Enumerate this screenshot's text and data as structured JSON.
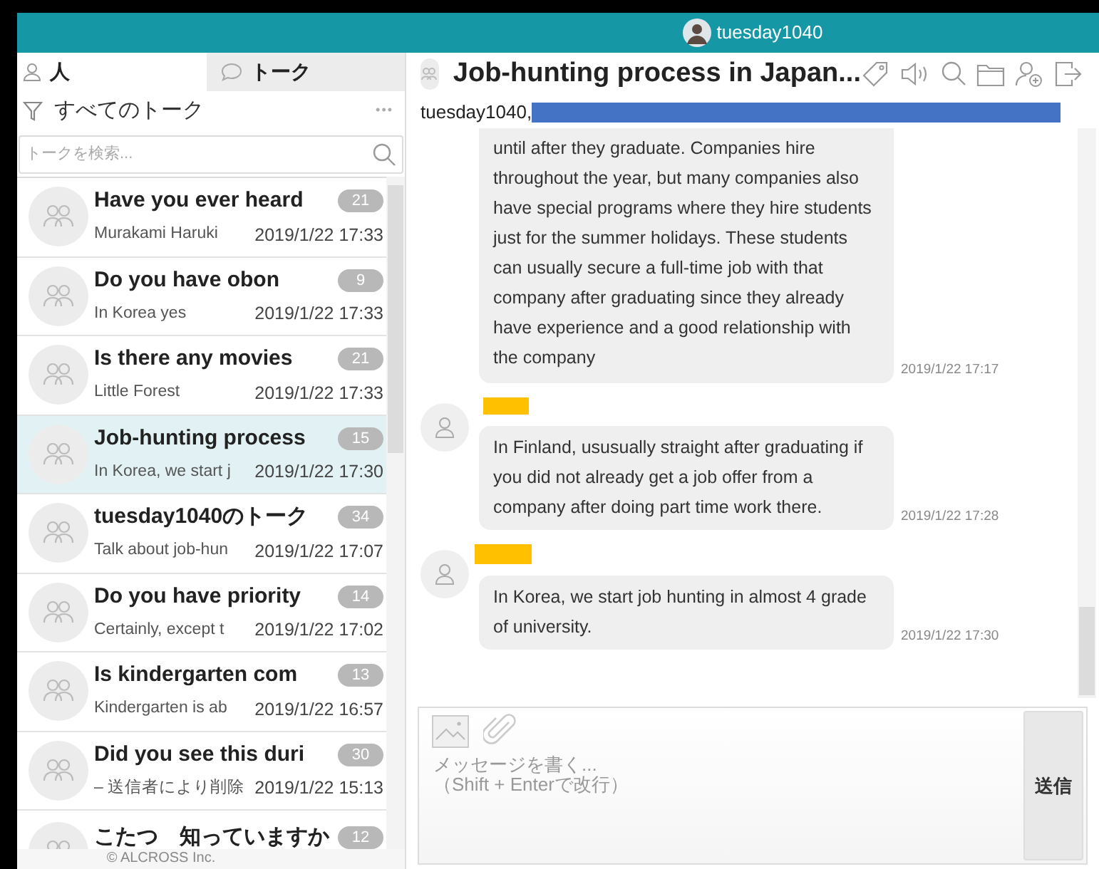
{
  "app_bar": {
    "user": "tuesday1040"
  },
  "tabs": [
    {
      "label": "人",
      "kind": "people",
      "selected": false
    },
    {
      "label": "トーク",
      "kind": "talk",
      "selected": true
    }
  ],
  "filter": {
    "label": "すべてのトーク",
    "more": "•••"
  },
  "search": {
    "placeholder": "トークを検索..."
  },
  "talks": [
    {
      "title": "Have you ever heard",
      "preview": "Murakami Haruki",
      "time": "2019/1/22 17:33",
      "count": "21",
      "selected": false
    },
    {
      "title": "Do you have obon",
      "preview": "In Korea yes",
      "time": "2019/1/22 17:33",
      "count": "9",
      "selected": false
    },
    {
      "title": "Is there any movies",
      "preview": "Little Forest",
      "time": "2019/1/22 17:33",
      "count": "21",
      "selected": false
    },
    {
      "title": "Job-hunting process",
      "preview": "In Korea, we start j",
      "time": "2019/1/22 17:30",
      "count": "15",
      "selected": true
    },
    {
      "title": "tuesday1040のトーク",
      "preview": "Talk about job-hun",
      "time": "2019/1/22 17:07",
      "count": "34",
      "selected": false
    },
    {
      "title": "Do you have priority",
      "preview": "Certainly, except t",
      "time": "2019/1/22 17:02",
      "count": "14",
      "selected": false
    },
    {
      "title": "Is kindergarten com",
      "preview": "Kindergarten is ab",
      "time": "2019/1/22 16:57",
      "count": "13",
      "selected": false
    },
    {
      "title": "Did you see this duri",
      "preview": "– 送信者により削除",
      "time": "2019/1/22 15:13",
      "count": "30",
      "selected": false
    },
    {
      "title": "こたつ　知っていますか",
      "count": "12",
      "selected": false
    }
  ],
  "footer": "© ALCROSS Inc.",
  "chat": {
    "title": "Job-hunting process in Japan...",
    "members": "tuesday1040,",
    "messages": [
      {
        "kind": "continuation",
        "text": "until after they graduate. Companies hire throughout the year, but many companies also have special programs where they hire students just for the summer holidays. These students can usually secure a full-time job with that company after graduating since they already have experience and a good relationship with the company",
        "time": "2019/1/22 17:17"
      },
      {
        "kind": "with_sender",
        "text": "In Finland, ususually straight after graduating if you did not already get a job offer from a company after doing part time work there.",
        "time": "2019/1/22 17:28"
      },
      {
        "kind": "with_sender",
        "text": "In Korea, we start job hunting in almost 4 grade of university.",
        "time": "2019/1/22 17:30"
      }
    ]
  },
  "composer": {
    "placeholder": "メッセージを書く...\n（Shift + Enterで改行）",
    "send": "送信"
  }
}
